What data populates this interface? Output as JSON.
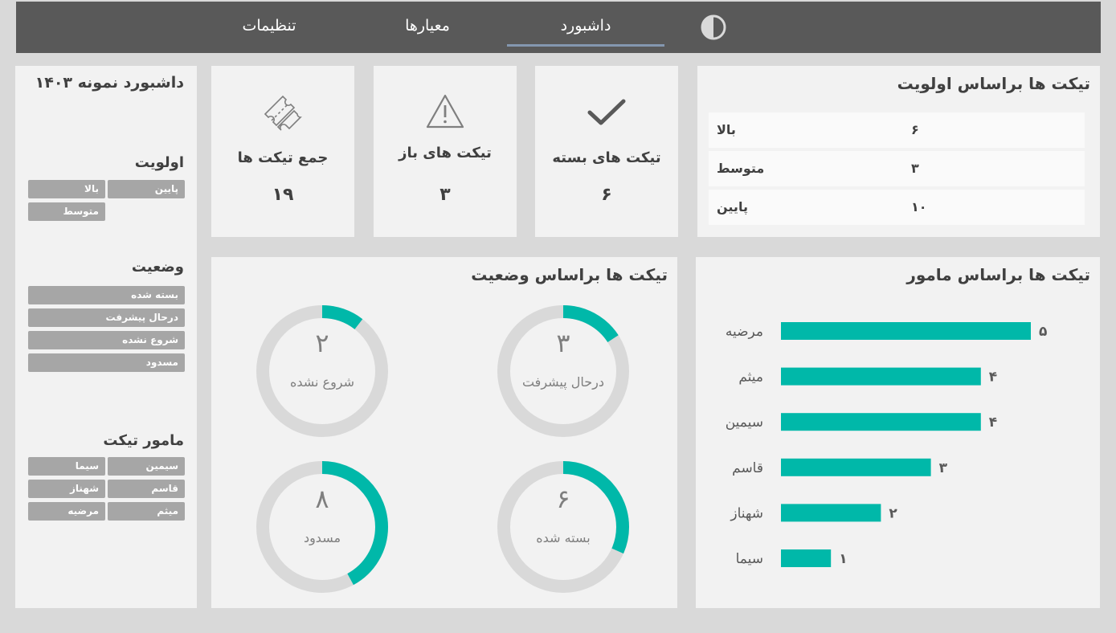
{
  "nav": {
    "tabs": [
      {
        "label": "تنظیمات",
        "active": false
      },
      {
        "label": "معیارها",
        "active": false
      },
      {
        "label": "داشبورد",
        "active": true
      }
    ],
    "theme_icon": "contrast-icon"
  },
  "sidebar": {
    "title": "داشبورد نمونه ۱۴۰۳",
    "priority": {
      "title": "اولویت",
      "items": [
        "پایین",
        "بالا",
        "متوسط"
      ]
    },
    "status": {
      "title": "وضعیت",
      "items": [
        "بسته شده",
        "درحال پیشرفت",
        "شروع نشده",
        "مسدود"
      ]
    },
    "agent": {
      "title": "مامور تیکت",
      "items": [
        "سیمین",
        "سیما",
        "قاسم",
        "شهناز",
        "میثم",
        "مرضیه"
      ]
    }
  },
  "kpis": {
    "total": {
      "label": "جمع تیکت ها",
      "value": "۱۹",
      "icon": "ticket-icon"
    },
    "open": {
      "label": "تیکت های باز",
      "value": "۳",
      "icon": "warning-icon"
    },
    "closed": {
      "label": "تیکت های بسته",
      "value": "۶",
      "icon": "checkmark-icon"
    }
  },
  "priority_table": {
    "title": "تیکت ها براساس اولویت",
    "rows": [
      {
        "name": "بالا",
        "value": "۶"
      },
      {
        "name": "متوسط",
        "value": "۳"
      },
      {
        "name": "پایین",
        "value": "۱۰"
      }
    ]
  },
  "status_chart": {
    "title": "تیکت ها براساس وضعیت",
    "donuts": [
      {
        "label": "درحال پیشرفت",
        "value": 3,
        "display": "۳",
        "fraction": 0.158
      },
      {
        "label": "شروع نشده",
        "value": 2,
        "display": "۲",
        "fraction": 0.105
      },
      {
        "label": "بسته شده",
        "value": 6,
        "display": "۶",
        "fraction": 0.316
      },
      {
        "label": "مسدود",
        "value": 8,
        "display": "۸",
        "fraction": 0.421
      }
    ]
  },
  "colors": {
    "accent": "#00b8a9",
    "track": "#d9d9d9",
    "nav_bg": "#595959",
    "card_bg": "#f2f2f2",
    "tab_underline": "#8497b0"
  },
  "chart_data": {
    "type": "bar",
    "title": "تیکت ها براساس مامور",
    "categories": [
      "مرضیه",
      "میثم",
      "سیمین",
      "قاسم",
      "شهناز",
      "سیما"
    ],
    "values": [
      5,
      4,
      4,
      3,
      2,
      1
    ],
    "value_labels": [
      "۵",
      "۴",
      "۴",
      "۳",
      "۲",
      "۱"
    ],
    "orientation": "horizontal",
    "xlim": [
      0,
      5
    ],
    "grid": false
  }
}
